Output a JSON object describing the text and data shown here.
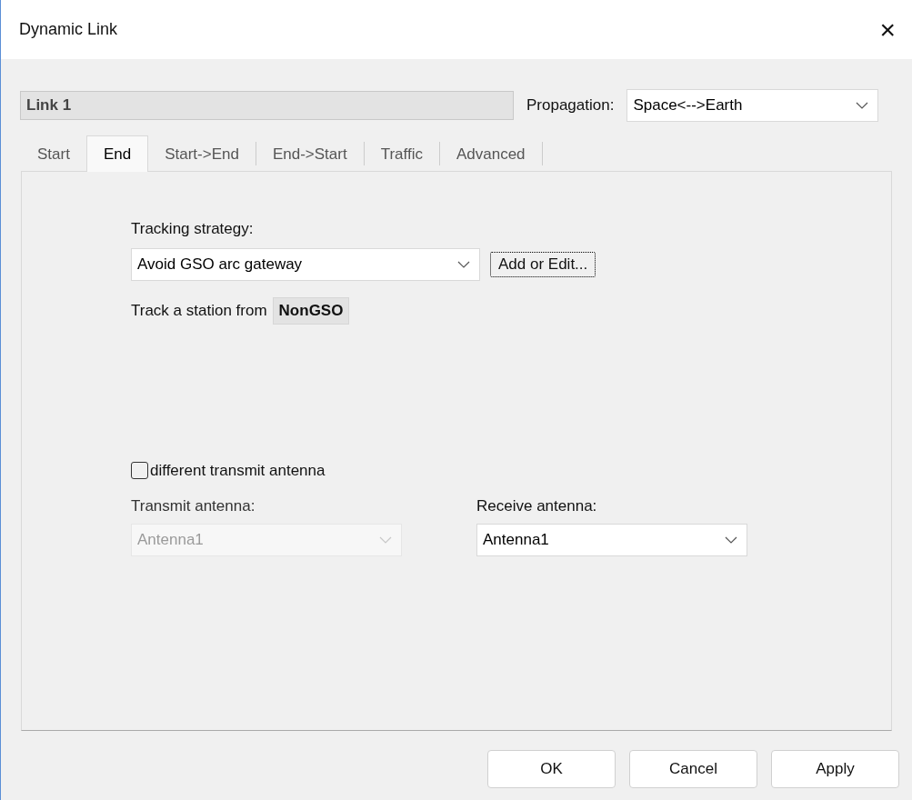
{
  "window": {
    "title": "Dynamic Link",
    "close": "×"
  },
  "link_name": "Link 1",
  "propagation": {
    "label": "Propagation:",
    "value": "Space<-->Earth"
  },
  "tabs": [
    {
      "label": "Start",
      "selected": false
    },
    {
      "label": "End",
      "selected": true
    },
    {
      "label": "Start->End",
      "selected": false
    },
    {
      "label": "End->Start",
      "selected": false
    },
    {
      "label": "Traffic",
      "selected": false
    },
    {
      "label": "Advanced",
      "selected": false
    }
  ],
  "tracking": {
    "label": "Tracking strategy:",
    "value": "Avoid GSO arc gateway",
    "button": "Add or Edit..."
  },
  "track_from": {
    "label": "Track a station from",
    "value": "NonGSO"
  },
  "different_antenna": {
    "label": "different transmit antenna",
    "checked": false
  },
  "transmit": {
    "label": "Transmit antenna:",
    "value": "Antenna1",
    "disabled": true
  },
  "receive": {
    "label": "Receive antenna:",
    "value": "Antenna1",
    "disabled": false
  },
  "buttons": [
    "OK",
    "Cancel",
    "Apply"
  ]
}
